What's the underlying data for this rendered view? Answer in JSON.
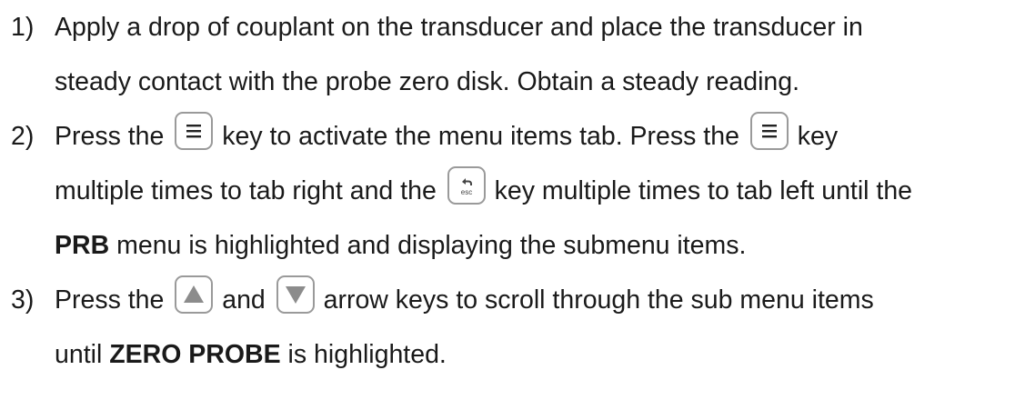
{
  "steps": [
    {
      "number": "1)",
      "line1": "Apply a drop of couplant on the transducer and place the transducer in",
      "line2": "steady contact with the probe zero disk.  Obtain a steady reading."
    },
    {
      "number": "2)",
      "line1_a": "Press the ",
      "line1_b": " key to activate the menu items tab.  Press the ",
      "line1_c": " key",
      "line2_a": "multiple times to tab right and the ",
      "line2_b": " key multiple times to tab left until the",
      "line3_bold": "PRB",
      "line3_rest": " menu is highlighted and displaying the submenu items."
    },
    {
      "number": "3)",
      "line1_a": "Press the ",
      "line1_b": " and ",
      "line1_c": " arrow keys to scroll through the sub menu items",
      "line2_a": "until ",
      "line2_bold": "ZERO PROBE",
      "line2_rest": " is highlighted."
    }
  ],
  "icons": {
    "menu": "menu-key-icon",
    "esc": "esc-key-icon",
    "esc_label": "esc",
    "up": "up-arrow-key-icon",
    "down": "down-arrow-key-icon"
  },
  "colors": {
    "text": "#1a1a1a",
    "key_border": "#9a9a9a",
    "arrow_fill": "#8c8c8c"
  }
}
